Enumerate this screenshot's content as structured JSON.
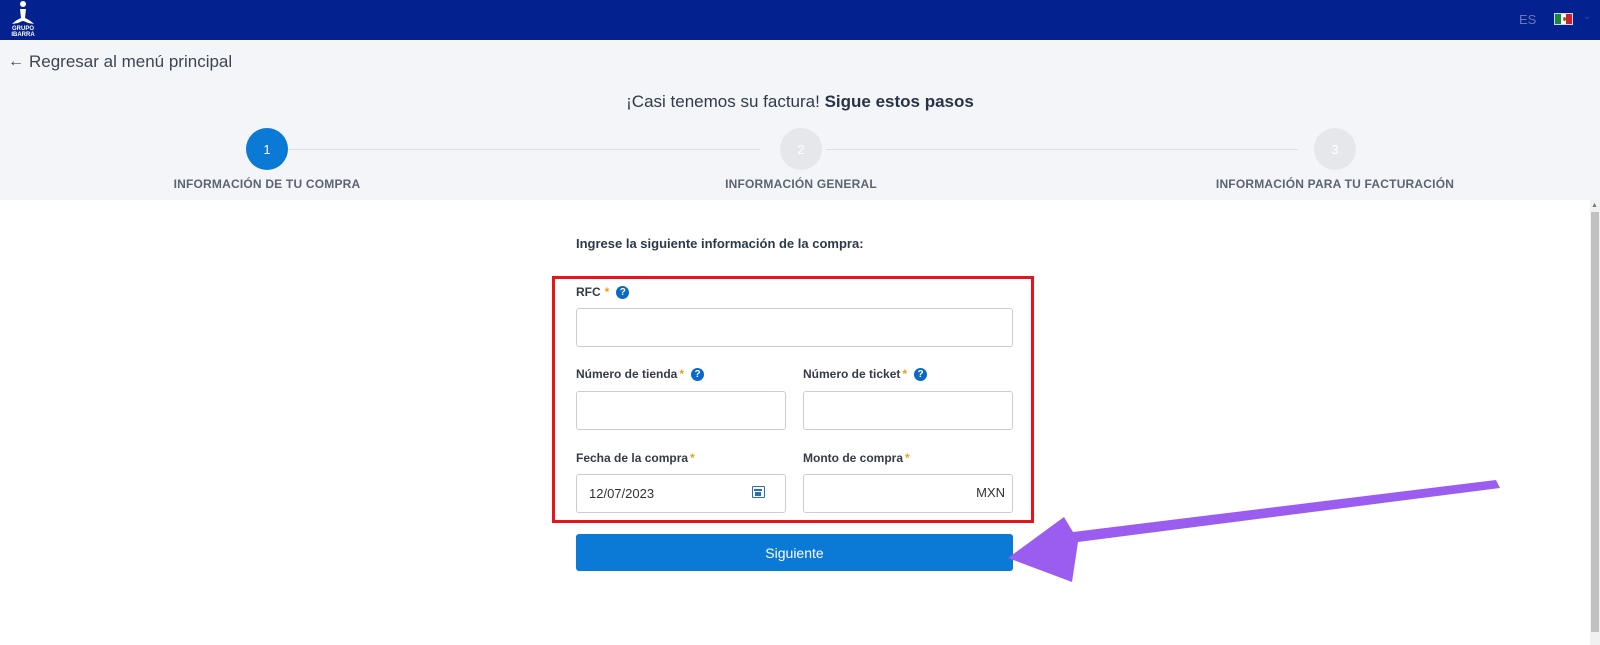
{
  "header": {
    "logo_text": "GRUPO IBARRA",
    "language": "ES"
  },
  "nav": {
    "back_arrow": "←",
    "back_label": "Regresar al menú principal"
  },
  "headline": {
    "prefix": "¡Casi tenemos su factura!",
    "emphasis": "Sigue estos pasos"
  },
  "steps": [
    {
      "number": "1",
      "label": "INFORMACIÓN DE TU COMPRA",
      "state": "active"
    },
    {
      "number": "2",
      "label": "INFORMACIÓN GENERAL",
      "state": "inactive"
    },
    {
      "number": "3",
      "label": "INFORMACIÓN PARA TU FACTURACIÓN",
      "state": "inactive"
    }
  ],
  "form": {
    "intro": "Ingrese la siguiente información de la compra:",
    "required_mark": "*",
    "help_mark": "?",
    "rfc": {
      "label": "RFC",
      "value": ""
    },
    "store_number": {
      "label": "Número de tienda",
      "value": ""
    },
    "ticket_number": {
      "label": "Número de ticket",
      "value": ""
    },
    "purchase_date": {
      "label": "Fecha de la compra",
      "value": "12/07/2023"
    },
    "purchase_amount": {
      "label": "Monto de compra",
      "value": "",
      "suffix": "MXN"
    },
    "submit_label": "Siguiente"
  },
  "colors": {
    "topbar": "#03218f",
    "primary": "#0a7ad6",
    "highlight_box": "#e8141c",
    "annotation_arrow": "#9b5cf0",
    "required": "#e7a21a"
  }
}
